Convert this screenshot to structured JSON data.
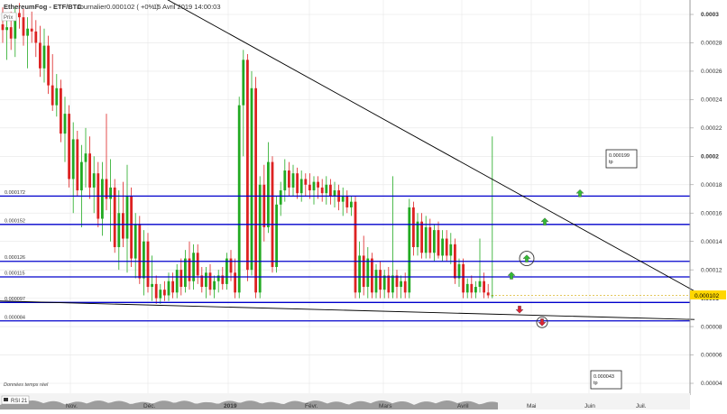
{
  "header": {
    "instrument": "EthereumFog - ETF/BTC",
    "period": "Journalier",
    "price": "0.000102 ( +0% )",
    "datetime": "15 Avril 2019 14:00:03"
  },
  "labels": {
    "price_tag": "Prix",
    "realtime_note": "Données temps réel",
    "rsi_tab": "RSI 21"
  },
  "colors": {
    "level_line": "#0000cc",
    "trend_line": "#000000",
    "candle_up": "#22aa22",
    "candle_down": "#dd2222",
    "arrow_up": "#33bb33",
    "arrow_down": "#dd2233",
    "current_price_tag": "#ffd700",
    "grid": "#e6e6e6"
  },
  "chart_data": {
    "type": "candlestick",
    "x_axis": {
      "ticks": [
        "Nov.",
        "Déc.",
        "2019",
        "Févr.",
        "Mars",
        "Avril",
        "Mai",
        "Juin",
        "Juil."
      ]
    },
    "y_axis": {
      "ylim": [
        4e-05,
        0.00031
      ],
      "ticks": [
        "0.0003",
        "0.00028",
        "0.00026",
        "0.00024",
        "0.00022",
        "0.0002",
        "0.00018",
        "0.00016",
        "0.00014",
        "0.00012",
        "0.0001",
        "0.00008",
        "0.00006",
        "0.00004"
      ]
    },
    "horizontal_levels": [
      {
        "value": 0.000172,
        "label": "0.000172"
      },
      {
        "value": 0.000152,
        "label": "0.000152"
      },
      {
        "value": 0.000126,
        "label": "0.000126"
      },
      {
        "value": 0.000115,
        "label": "0.000115"
      },
      {
        "value": 9.7e-05,
        "label": "0.000097"
      },
      {
        "value": 8.4e-05,
        "label": "0.000084"
      }
    ],
    "current_price": {
      "value": 0.000102,
      "label": "0.000102"
    },
    "targets": [
      {
        "value": "0.000199",
        "tag": "tp"
      },
      {
        "value": "0.000043",
        "tag": "tp"
      }
    ],
    "trendlines": [
      {
        "name": "descending-resistance",
        "from": {
          "date": "Déc.",
          "price": 0.000318
        },
        "to": {
          "date": "Juil.",
          "price": 0.000105
        }
      },
      {
        "name": "support",
        "from": {
          "date": "Oct.",
          "price": 9.8e-05
        },
        "to": {
          "date": "Juil.",
          "price": 8.5e-05
        }
      }
    ],
    "signals": [
      {
        "direction": "up",
        "price": 0.000116
      },
      {
        "direction": "up",
        "price": 0.000128,
        "circled": true
      },
      {
        "direction": "up",
        "price": 0.000154
      },
      {
        "direction": "up",
        "price": 0.000174
      },
      {
        "direction": "down",
        "price": 9.2e-05
      },
      {
        "direction": "down",
        "price": 8.3e-05,
        "circled": true
      }
    ],
    "candles": {
      "columns": [
        "open",
        "high",
        "low",
        "close"
      ],
      "values": [
        [
          0.000293,
          0.000305,
          0.00028,
          0.000289
        ],
        [
          0.000289,
          0.0003,
          0.000268,
          0.000291
        ],
        [
          0.000291,
          0.000302,
          0.000275,
          0.000283
        ],
        [
          0.000283,
          0.000306,
          0.00027,
          0.000301
        ],
        [
          0.000301,
          0.000308,
          0.00029,
          0.000298
        ],
        [
          0.000298,
          0.000304,
          0.000278,
          0.000285
        ],
        [
          0.000285,
          0.000298,
          0.000262,
          0.00029
        ],
        [
          0.00029,
          0.000302,
          0.00028,
          0.000288
        ],
        [
          0.000288,
          0.000296,
          0.00027,
          0.00028
        ],
        [
          0.00028,
          0.000292,
          0.000256,
          0.000262
        ],
        [
          0.000262,
          0.00029,
          0.000252,
          0.000278
        ],
        [
          0.000278,
          0.000285,
          0.000244,
          0.00025
        ],
        [
          0.00025,
          0.000272,
          0.000232,
          0.000236
        ],
        [
          0.000236,
          0.000258,
          0.000228,
          0.000248
        ],
        [
          0.000248,
          0.000254,
          0.00021,
          0.000216
        ],
        [
          0.000216,
          0.000242,
          0.000196,
          0.00023
        ],
        [
          0.00023,
          0.000236,
          0.000178,
          0.000184
        ],
        [
          0.000184,
          0.000224,
          0.00016,
          0.000212
        ],
        [
          0.000212,
          0.000218,
          0.000172,
          0.000176
        ],
        [
          0.000176,
          0.000208,
          0.00015,
          0.000196
        ],
        [
          0.000196,
          0.00022,
          0.000178,
          0.000202
        ],
        [
          0.000202,
          0.000214,
          0.00017,
          0.000178
        ],
        [
          0.000178,
          0.0002,
          0.00016,
          0.000188
        ],
        [
          0.000188,
          0.000196,
          0.00015,
          0.000156
        ],
        [
          0.000156,
          0.000196,
          0.000144,
          0.000184
        ],
        [
          0.000184,
          0.00023,
          0.000162,
          0.00017
        ],
        [
          0.00017,
          0.000198,
          0.00014,
          0.000178
        ],
        [
          0.000178,
          0.000184,
          0.000132,
          0.000136
        ],
        [
          0.000136,
          0.000176,
          0.00012,
          0.00016
        ],
        [
          0.00016,
          0.000182,
          0.000136,
          0.000142
        ],
        [
          0.000142,
          0.000194,
          0.000118,
          0.000172
        ],
        [
          0.000172,
          0.000178,
          0.000122,
          0.000128
        ],
        [
          0.000128,
          0.00016,
          0.000114,
          0.000152
        ],
        [
          0.000152,
          0.000158,
          0.00011,
          0.000114
        ],
        [
          0.000114,
          0.000148,
          0.000102,
          0.00014
        ],
        [
          0.00014,
          0.000146,
          0.000104,
          0.000108
        ],
        [
          0.000108,
          0.00013,
          9.8e-05,
          0.00011
        ],
        [
          0.00011,
          0.000116,
          9.6e-05,
          0.0001
        ],
        [
          0.0001,
          0.00011,
          9.6e-05,
          0.000106
        ],
        [
          0.000106,
          0.000112,
          9.8e-05,
          0.000102
        ],
        [
          0.000102,
          0.000118,
          9.8e-05,
          0.000112
        ],
        [
          0.000112,
          0.000118,
          0.0001,
          0.000104
        ],
        [
          0.000104,
          0.000124,
          0.0001,
          0.00012
        ],
        [
          0.00012,
          0.000128,
          0.000102,
          0.000108
        ],
        [
          0.000108,
          0.000134,
          0.000104,
          0.000128
        ],
        [
          0.000128,
          0.00014,
          0.000106,
          0.000112
        ],
        [
          0.000112,
          0.000138,
          0.000106,
          0.000132
        ],
        [
          0.000132,
          0.000138,
          0.00011,
          0.000116
        ],
        [
          0.000116,
          0.000122,
          0.000104,
          0.000108
        ],
        [
          0.000108,
          0.000122,
          0.0001,
          0.000118
        ],
        [
          0.000118,
          0.000124,
          0.000102,
          0.000106
        ],
        [
          0.000106,
          0.000116,
          0.0001,
          0.000112
        ],
        [
          0.000112,
          0.00012,
          0.000104,
          0.000116
        ],
        [
          0.000116,
          0.000122,
          0.000106,
          0.00011
        ],
        [
          0.00011,
          0.000132,
          0.000106,
          0.000128
        ],
        [
          0.000128,
          0.000134,
          0.000112,
          0.000118
        ],
        [
          0.000118,
          0.000128,
          0.0001,
          0.000104
        ],
        [
          0.000104,
          0.000242,
          0.0001,
          0.000236
        ],
        [
          0.000236,
          0.000275,
          0.0002,
          0.000268
        ],
        [
          0.000268,
          0.000272,
          0.000112,
          0.00012
        ],
        [
          0.00012,
          0.00026,
          0.000116,
          0.000248
        ],
        [
          0.000248,
          0.000256,
          0.0001,
          0.000104
        ],
        [
          0.000104,
          0.000186,
          0.0001,
          0.00018
        ],
        [
          0.00018,
          0.000194,
          0.00014,
          0.00015
        ],
        [
          0.00015,
          0.00021,
          0.000146,
          0.000196
        ],
        [
          0.000196,
          0.0002,
          0.000118,
          0.000122
        ],
        [
          0.000122,
          0.000172,
          0.000118,
          0.000166
        ],
        [
          0.000166,
          0.000182,
          0.000158,
          0.000176
        ],
        [
          0.000176,
          0.000198,
          0.000168,
          0.00019
        ],
        [
          0.00019,
          0.000196,
          0.000172,
          0.000178
        ],
        [
          0.000178,
          0.000194,
          0.000172,
          0.000188
        ],
        [
          0.000188,
          0.000192,
          0.00017,
          0.000174
        ],
        [
          0.000174,
          0.00019,
          0.000168,
          0.000184
        ],
        [
          0.000184,
          0.000188,
          0.000172,
          0.00018
        ],
        [
          0.00018,
          0.000188,
          0.00017,
          0.000176
        ],
        [
          0.000176,
          0.000186,
          0.000166,
          0.000182
        ],
        [
          0.000182,
          0.000186,
          0.00017,
          0.000178
        ],
        [
          0.000178,
          0.000184,
          0.000168,
          0.000174
        ],
        [
          0.000174,
          0.000186,
          0.000166,
          0.00018
        ],
        [
          0.00018,
          0.000184,
          0.000166,
          0.000172
        ],
        [
          0.000172,
          0.000182,
          0.000164,
          0.000176
        ],
        [
          0.000176,
          0.00018,
          0.000162,
          0.000168
        ],
        [
          0.000168,
          0.000178,
          0.000158,
          0.000172
        ],
        [
          0.000172,
          0.000176,
          0.00016,
          0.000164
        ],
        [
          0.000164,
          0.000172,
          0.000158,
          0.000168
        ],
        [
          0.000168,
          0.000172,
          0.0001,
          0.000104
        ],
        [
          0.000104,
          0.00014,
          0.0001,
          0.00013
        ],
        [
          0.00013,
          0.000144,
          0.000102,
          0.000108
        ],
        [
          0.000108,
          0.000136,
          0.0001,
          0.000128
        ],
        [
          0.000128,
          0.000132,
          0.0001,
          0.000104
        ],
        [
          0.000104,
          0.000124,
          0.0001,
          0.00012
        ],
        [
          0.00012,
          0.000126,
          0.0001,
          0.000106
        ],
        [
          0.000106,
          0.00012,
          0.0001,
          0.000116
        ],
        [
          0.000116,
          0.000122,
          0.0001,
          0.000104
        ],
        [
          0.000104,
          0.000186,
          0.0001,
          0.000116
        ],
        [
          0.000116,
          0.00012,
          0.0001,
          0.000108
        ],
        [
          0.000108,
          0.000116,
          0.0001,
          0.000112
        ],
        [
          0.000112,
          0.000118,
          0.0001,
          0.000104
        ],
        [
          0.000104,
          0.00017,
          0.0001,
          0.000164
        ],
        [
          0.000164,
          0.000168,
          0.00013,
          0.000136
        ],
        [
          0.000136,
          0.00016,
          0.00013,
          0.000154
        ],
        [
          0.000154,
          0.00016,
          0.000128,
          0.000132
        ],
        [
          0.000132,
          0.000158,
          0.000128,
          0.00015
        ],
        [
          0.00015,
          0.000156,
          0.000128,
          0.000132
        ],
        [
          0.000132,
          0.000152,
          0.000126,
          0.000148
        ],
        [
          0.000148,
          0.000154,
          0.000128,
          0.00013
        ],
        [
          0.00013,
          0.000148,
          0.000126,
          0.000142
        ],
        [
          0.000142,
          0.000148,
          0.000126,
          0.00013
        ],
        [
          0.00013,
          0.000146,
          0.000124,
          0.000138
        ],
        [
          0.000138,
          0.000142,
          0.00011,
          0.000114
        ],
        [
          0.000114,
          0.000128,
          0.000108,
          0.000124
        ],
        [
          0.000124,
          0.000128,
          0.0001,
          0.000104
        ],
        [
          0.000104,
          0.000114,
          0.0001,
          0.00011
        ],
        [
          0.00011,
          0.000116,
          0.0001,
          0.000104
        ],
        [
          0.000104,
          0.000112,
          0.0001,
          0.000108
        ],
        [
          0.000108,
          0.000142,
          0.000104,
          0.000112
        ],
        [
          0.000112,
          0.000118,
          0.0001,
          0.000104
        ],
        [
          0.000104,
          0.00011,
          0.0001,
          0.000102
        ],
        [
          0.000102,
          0.000214,
          0.0001,
          0.000102
        ]
      ]
    },
    "panels": [
      "RSI 21"
    ]
  }
}
